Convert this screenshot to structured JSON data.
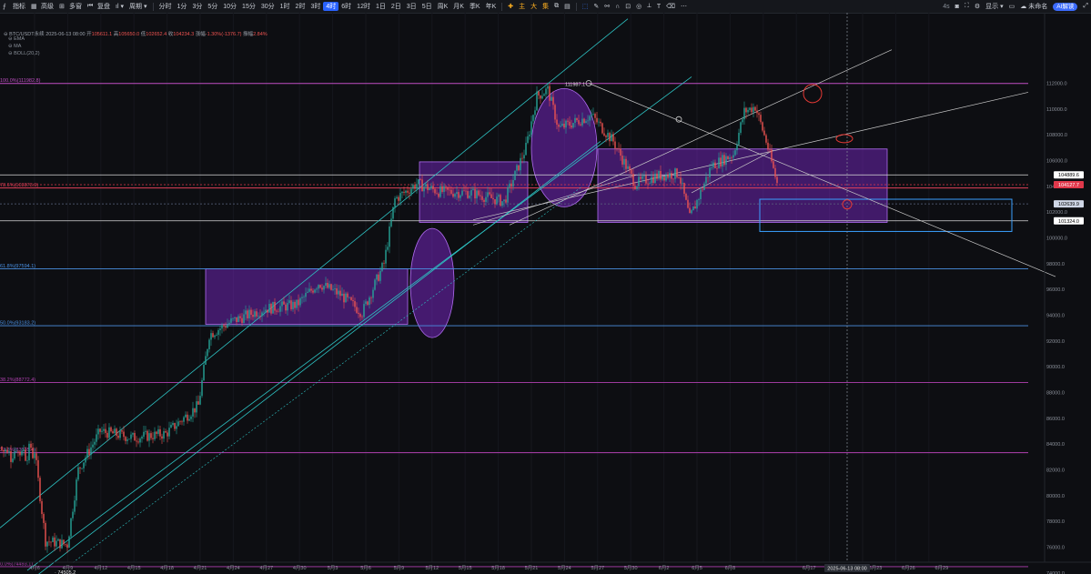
{
  "toolbar": {
    "indicators": "指标",
    "advanced": "高级",
    "multi_window": "多窗",
    "replay": "复盘",
    "cycle": "周期",
    "timeframes": [
      "分时",
      "1分",
      "3分",
      "5分",
      "10分",
      "15分",
      "30分",
      "1时",
      "2时",
      "3时",
      "4时",
      "6时",
      "12时",
      "1日",
      "2日",
      "3日",
      "5日",
      "周K",
      "月K",
      "季K",
      "年K"
    ],
    "active_timeframe": "4时",
    "draw_tools": [
      "主",
      "大",
      "集"
    ],
    "zoom": "4s",
    "display": "显示",
    "user": "未命名",
    "ai_button": "AI解读"
  },
  "infobar": {
    "symbol": "BTC/USDT永续",
    "datetime": "2025-06-13 08:00",
    "open_label": "开",
    "open": "105611.1",
    "high_label": "高",
    "high": "105650.0",
    "low_label": "低",
    "low": "102652.4",
    "close_label": "收",
    "close": "104234.3",
    "change_label": "涨幅",
    "change": "-1.30%(-1376.7)",
    "amp_label": "振幅",
    "amp": "2.84%"
  },
  "indicators": [
    "EMA",
    "MA",
    "BOLL(20,2)"
  ],
  "fib_labels": [
    {
      "text": "100.0%(111982.8)",
      "price": 111983,
      "color": "#c04fc4"
    },
    {
      "text": "78.6%(103873.9)",
      "price": 103874,
      "color": "#e0405a"
    },
    {
      "text": "61.8%(97594.1)",
      "price": 97594,
      "color": "#4a90e2"
    },
    {
      "text": "50.0%(93183.2)",
      "price": 93183,
      "color": "#4a90e2"
    },
    {
      "text": "38.2%(88772.4)",
      "price": 88772,
      "color": "#b040b0"
    },
    {
      "text": "23.6%(83335.4)",
      "price": 83335,
      "color": "#b040b0"
    },
    {
      "text": "0.0%(74493.1)",
      "price": 74493,
      "color": "#b040b0"
    }
  ],
  "high_marker": "111987.1",
  "low_marker": "74505.2",
  "price_axis": {
    "ticks": [
      "112000.0",
      "110000.0",
      "108000.0",
      "106000.0",
      "104000.0",
      "102000.0",
      "100000.0",
      "98000.0",
      "96000.0",
      "94000.0",
      "92000.0",
      "90000.0",
      "88000.0",
      "86000.0",
      "84000.0",
      "82000.0",
      "80000.0",
      "78000.0",
      "76000.0",
      "74000.0"
    ],
    "tags": [
      {
        "text": "104889.6",
        "price": 104890,
        "bg": "#ffffff",
        "fg": "#000000"
      },
      {
        "text": "104127.7",
        "price": 104128,
        "bg": "#e0384b",
        "fg": "#ffffff"
      },
      {
        "text": "102639.9",
        "price": 102640,
        "bg": "#cfd6e6",
        "fg": "#000000"
      },
      {
        "text": "101324.0",
        "price": 101324,
        "bg": "#ffffff",
        "fg": "#000000"
      }
    ]
  },
  "time_axis": {
    "ticks": [
      "4月6",
      "4月9",
      "4月12",
      "4月15",
      "4月18",
      "4月21",
      "4月24",
      "4月27",
      "4月30",
      "5月3",
      "5月6",
      "5月9",
      "5月12",
      "5月15",
      "5月18",
      "5月21",
      "5月24",
      "5月27",
      "5月30",
      "6月2",
      "6月5",
      "6月8",
      "6月11",
      "6月17",
      "6月20",
      "6月23",
      "6月26",
      "6月29"
    ],
    "cursor": "2025-06-13 08:00"
  },
  "colors": {
    "bull": "#26a69a",
    "bear": "#ef5350",
    "zone": "#8a2be2",
    "channel": "#2ec4c4",
    "trend": "#c8c8c8"
  },
  "chart_data": {
    "type": "candlestick",
    "symbol": "BTC/USDT永续",
    "interval": "4时",
    "xlim": [
      "2025-04-06",
      "2025-06-30"
    ],
    "ylim": [
      73500,
      113500
    ],
    "key_prices": [
      {
        "label": "high",
        "value": 111987.1
      },
      {
        "label": "low",
        "value": 74505.2
      },
      {
        "label": "open",
        "value": 105611.1
      },
      {
        "label": "close",
        "value": 104234.3
      }
    ],
    "approx_path": [
      [
        "2025-04-06",
        83500
      ],
      [
        "2025-04-07",
        76500
      ],
      [
        "2025-04-09",
        76200
      ],
      [
        "2025-04-10",
        82000
      ],
      [
        "2025-04-12",
        85000
      ],
      [
        "2025-04-15",
        84500
      ],
      [
        "2025-04-18",
        84800
      ],
      [
        "2025-04-21",
        87000
      ],
      [
        "2025-04-22",
        92500
      ],
      [
        "2025-04-24",
        93500
      ],
      [
        "2025-04-27",
        94500
      ],
      [
        "2025-04-30",
        94800
      ],
      [
        "2025-05-02",
        96500
      ],
      [
        "2025-05-04",
        95600
      ],
      [
        "2025-05-06",
        94200
      ],
      [
        "2025-05-08",
        98000
      ],
      [
        "2025-05-09",
        103000
      ],
      [
        "2025-05-11",
        104200
      ],
      [
        "2025-05-13",
        103600
      ],
      [
        "2025-05-16",
        103500
      ],
      [
        "2025-05-19",
        102800
      ],
      [
        "2025-05-21",
        107000
      ],
      [
        "2025-05-22",
        111000
      ],
      [
        "2025-05-23",
        111500
      ],
      [
        "2025-05-24",
        108500
      ],
      [
        "2025-05-27",
        109500
      ],
      [
        "2025-05-29",
        107500
      ],
      [
        "2025-05-31",
        104200
      ],
      [
        "2025-06-02",
        104800
      ],
      [
        "2025-06-04",
        105000
      ],
      [
        "2025-06-05",
        101500
      ],
      [
        "2025-06-07",
        105600
      ],
      [
        "2025-06-09",
        106500
      ],
      [
        "2025-06-10",
        109800
      ],
      [
        "2025-06-11",
        110200
      ],
      [
        "2025-06-12",
        107500
      ],
      [
        "2025-06-13",
        104234
      ]
    ]
  }
}
